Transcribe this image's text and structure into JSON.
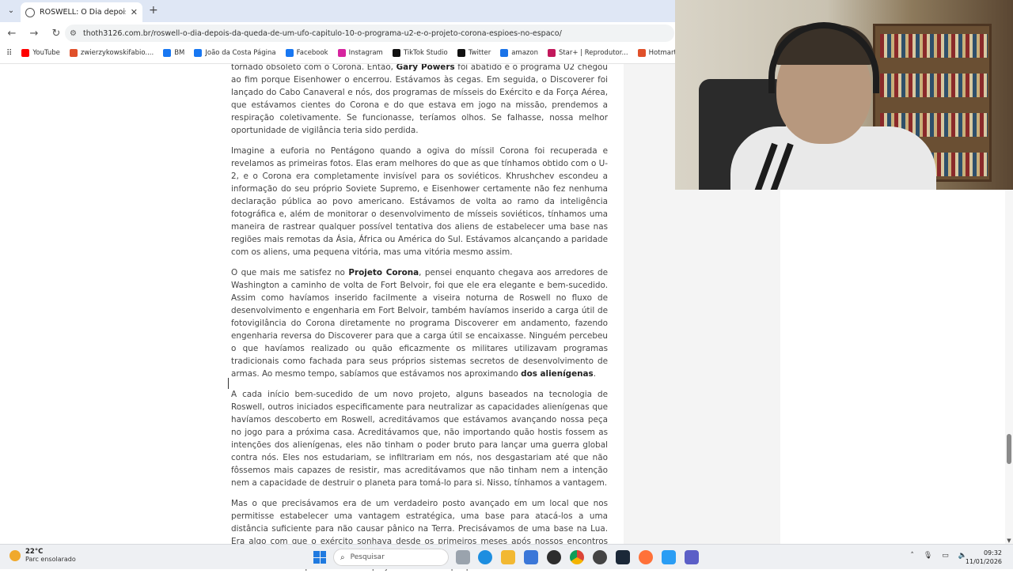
{
  "browser": {
    "tab_title": "ROSWELL: O Dia depois da que",
    "url": "thoth3126.com.br/roswell-o-dia-depois-da-queda-de-um-ufo-capitulo-10-o-programa-u2-e-o-projeto-corona-espioes-no-espaco/",
    "bookmarks": [
      {
        "label": "YouTube",
        "icon": "youtube-icon",
        "color": "#ff0000"
      },
      {
        "label": "zwierzykowskifabio....",
        "icon": "flame-icon",
        "color": "#e0502a"
      },
      {
        "label": "BM",
        "icon": "meta-icon",
        "color": "#1877f2"
      },
      {
        "label": "João da Costa Página",
        "icon": "facebook-icon",
        "color": "#1877f2"
      },
      {
        "label": "Facebook",
        "icon": "facebook-icon",
        "color": "#1877f2"
      },
      {
        "label": "Instagram",
        "icon": "instagram-icon",
        "color": "#d6249f"
      },
      {
        "label": "TikTok Studio",
        "icon": "tiktok-icon",
        "color": "#111111"
      },
      {
        "label": "Twitter",
        "icon": "x-icon",
        "color": "#111111"
      },
      {
        "label": "amazon",
        "icon": "amazon-icon",
        "color": "#1a73e8"
      },
      {
        "label": "Star+ | Reprodutor...",
        "icon": "star-icon",
        "color": "#c2185b"
      },
      {
        "label": "Hotmart - Minhas c...",
        "icon": "flame-icon",
        "color": "#e0502a"
      }
    ]
  },
  "article": {
    "paragraphs": [
      [
        {
          "t": "tornado obsoleto com o Corona. Então, "
        },
        {
          "t": "Gary Powers",
          "b": true
        },
        {
          "t": " foi abatido e o programa U2 chegou ao fim porque Eisenhower o encerrou. Estávamos às cegas. Em seguida, o Discoverer foi lançado do Cabo Canaveral e nós, dos programas de mísseis do Exército e da Força Aérea, que estávamos cientes do Corona e do que estava em jogo na missão, prendemos a respiração coletivamente. Se funcionasse, teríamos olhos. Se falhasse, nossa melhor oportunidade de vigilância teria sido perdida."
        }
      ],
      [
        {
          "t": "Imagine a euforia no Pentágono quando a ogiva do míssil Corona foi recuperada e revelamos as primeiras fotos. Elas eram melhores do que as que tínhamos obtido com o U-2, e o Corona era completamente invisível para os soviéticos. Khrushchev escondeu a informação do seu próprio Soviete Supremo, e Eisenhower certamente não fez nenhuma declaração pública ao povo americano. Estávamos de volta ao ramo da inteligência fotográfica e, além de monitorar o desenvolvimento de mísseis soviéticos, tínhamos uma maneira de rastrear qualquer possível tentativa dos aliens de estabelecer uma base nas regiões mais remotas da Ásia, África ou América do Sul. Estávamos alcançando a paridade com os aliens, uma pequena vitória, mas uma vitória mesmo assim."
        }
      ],
      [
        {
          "t": "O que mais me satisfez no "
        },
        {
          "t": "Projeto Corona",
          "b": true
        },
        {
          "t": ", pensei enquanto chegava aos arredores de Washington a caminho de volta de Fort Belvoir, foi que ele era elegante e bem-sucedido. Assim como havíamos inserido facilmente a viseira noturna de Roswell no fluxo de desenvolvimento e engenharia em Fort Belvoir, também havíamos inserido a carga útil de fotovigilância do Corona diretamente no programa Discoverer em andamento, fazendo engenharia reversa do Discoverer para que a carga útil se encaixasse. Ninguém percebeu o que havíamos realizado ou quão eficazmente os militares utilizavam programas tradicionais como fachada para seus próprios sistemas secretos de desenvolvimento de armas. Ao mesmo tempo, sabíamos que estávamos nos aproximando "
        },
        {
          "t": "dos alienígenas",
          "b": true
        },
        {
          "t": "."
        }
      ],
      [
        {
          "t": "A cada início bem-sucedido de um novo projeto, alguns baseados na tecnologia de Roswell, outros iniciados especificamente para neutralizar as capacidades alienígenas que havíamos descoberto em Roswell, acreditávamos que estávamos avançando nossa peça no jogo para a próxima casa. Acreditávamos que, não importando quão hostis fossem as intenções dos alienígenas, eles não tinham o poder bruto para lançar uma guerra global contra nós. Eles nos estudariam, se infiltrariam em nós, nos desgastariam até que não fôssemos mais capazes de resistir, mas acreditávamos que não tinham nem a intenção nem a capacidade de destruir o planeta para tomá-lo para si. Nisso, tínhamos a vantagem."
        }
      ],
      [
        {
          "t": "Mas o que precisávamos era de um verdadeiro posto avançado em um local que nos permitisse estabelecer uma vantagem estratégica, uma base para atacá-los a uma distância suficiente para não causar pânico na Terra. Precisávamos de uma base na Lua. Era algo com que o exército sonhava desde os primeiros meses após nossos encontros com os alienígenas nos arredores de Roswell, e algo que tentamos financiar sem o conhecimento do público. Era um projeto ambicioso que passou"
        }
      ]
    ]
  },
  "taskbar": {
    "temp": "22°C",
    "condition": "Parc ensolarado",
    "search_placeholder": "Pesquisar",
    "time": "09:32",
    "date": "11/01/2026"
  }
}
